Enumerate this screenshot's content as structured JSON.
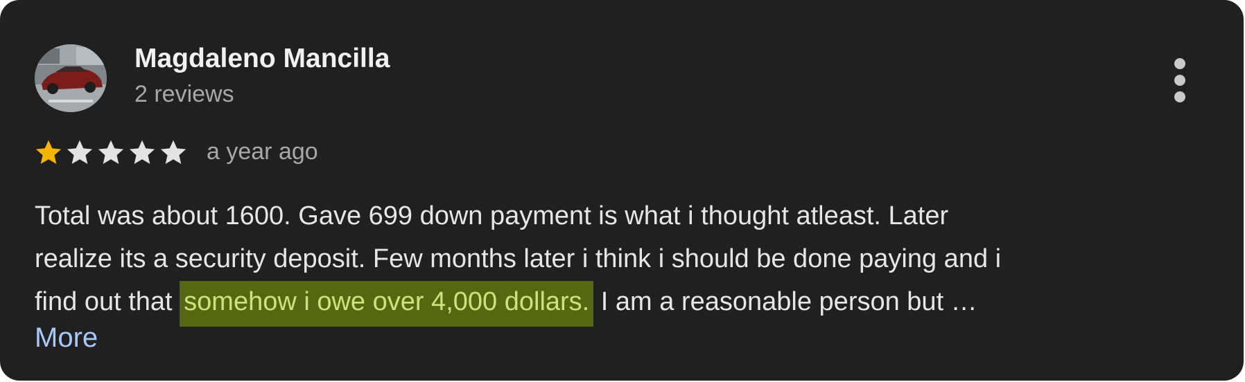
{
  "reviewer": {
    "name": "Magdaleno Mancilla",
    "reviews_count": "2 reviews"
  },
  "rating": {
    "value": 1,
    "max": 5,
    "filled_color": "#f4b400",
    "empty_color": "#e3e3e3"
  },
  "review": {
    "time_ago": "a year ago",
    "line1": "Total was about 1600. Gave 699 down payment is what i thought atleast. Later",
    "line2": "realize its a security deposit. Few months later i think i should be done paying and i",
    "line3_before": "find out that ",
    "line3_highlight": "somehow i owe over 4,000 dollars.",
    "line3_after": " I am a reasonable person but …",
    "more_label": "More"
  },
  "icons": {
    "overflow_menu": "more-vert-icon",
    "star": "star-icon"
  },
  "colors": {
    "card_background": "#202020",
    "highlight_background": "#566714",
    "highlight_text": "#cfe27a",
    "link": "#a8c7fa"
  }
}
